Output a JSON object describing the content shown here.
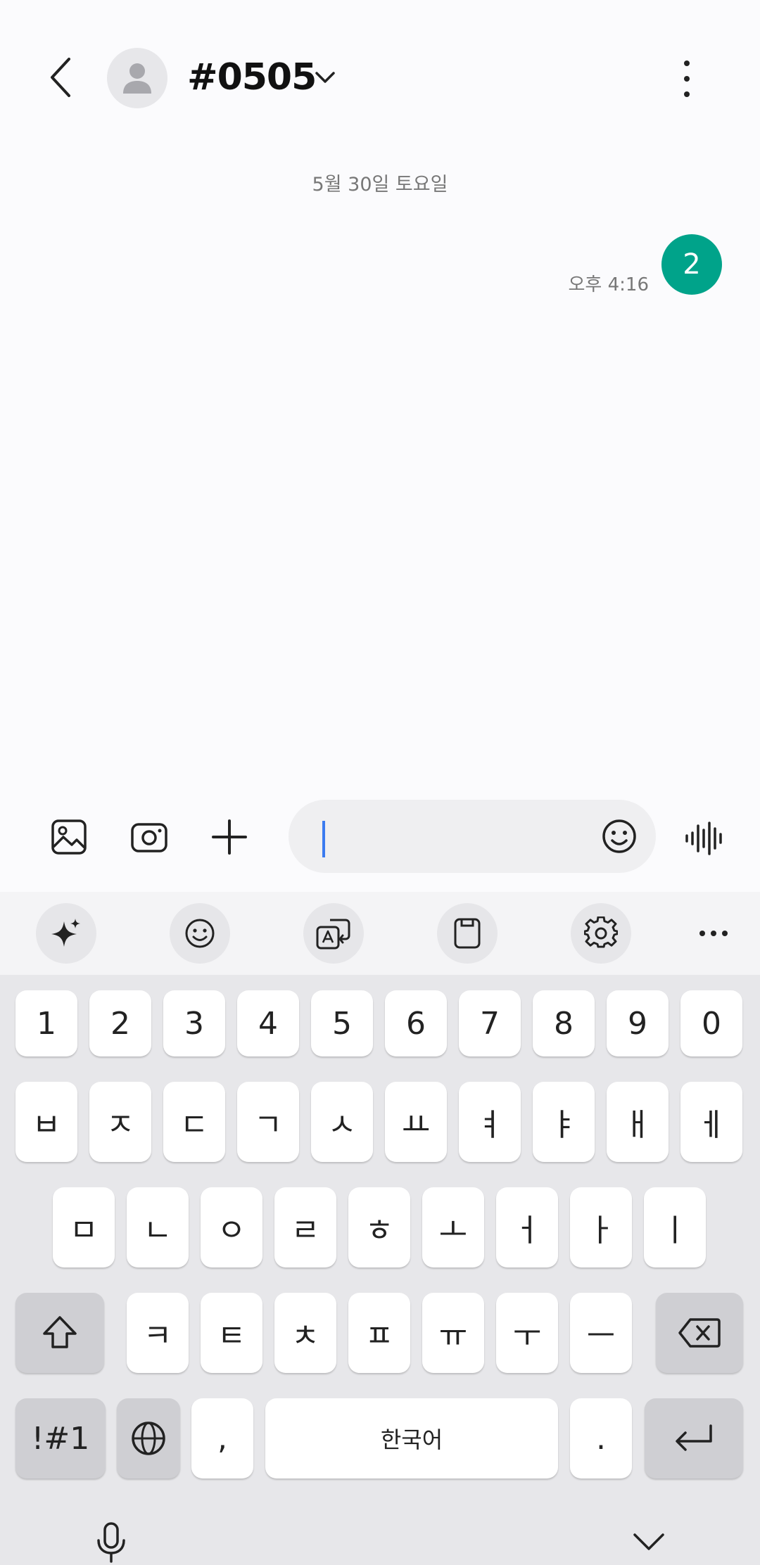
{
  "header": {
    "title": "#0505",
    "icons": [
      "back-icon",
      "avatar-icon",
      "chevron-down-icon",
      "more-options-icon"
    ]
  },
  "conversation": {
    "date_label": "5월 30일 토요일",
    "messages": [
      {
        "text": "2",
        "time": "오후 4:16",
        "color": "#00a38a"
      }
    ]
  },
  "compose": {
    "input_value": "",
    "icons": [
      "gallery-icon",
      "camera-icon",
      "add-icon",
      "emoji-icon",
      "voice-record-icon"
    ]
  },
  "keyboard_toolbar": {
    "icons": [
      "ai-sparkle-icon",
      "emoji-icon",
      "translate-icon",
      "clipboard-icon",
      "settings-icon",
      "more-horizontal-icon"
    ]
  },
  "keyboard": {
    "number_row": [
      "1",
      "2",
      "3",
      "4",
      "5",
      "6",
      "7",
      "8",
      "9",
      "0"
    ],
    "row1": [
      "ㅂ",
      "ㅈ",
      "ㄷ",
      "ㄱ",
      "ㅅ",
      "ㅛ",
      "ㅕ",
      "ㅑ",
      "ㅐ",
      "ㅔ"
    ],
    "row2": [
      "ㅁ",
      "ㄴ",
      "ㅇ",
      "ㄹ",
      "ㅎ",
      "ㅗ",
      "ㅓ",
      "ㅏ",
      "ㅣ"
    ],
    "row3": [
      "ㅋ",
      "ㅌ",
      "ㅊ",
      "ㅍ",
      "ㅠ",
      "ㅜ",
      "ㅡ"
    ],
    "symbols_label": "!#1",
    "comma_label": ",",
    "space_label": "한국어",
    "period_label": ".",
    "accent_color": "#00a38a",
    "caret_color": "#3b7bf0"
  }
}
